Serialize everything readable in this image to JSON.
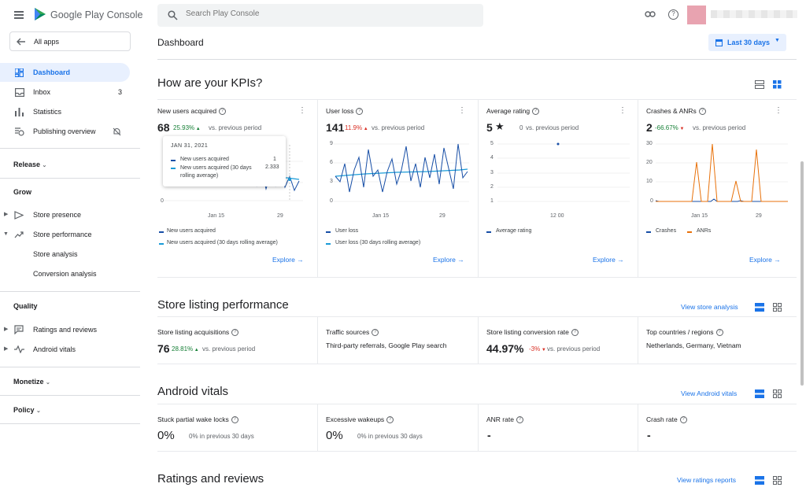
{
  "app": {
    "name": "Google Play Console"
  },
  "search": {
    "placeholder": "Search Play Console"
  },
  "sidebar": {
    "all_apps": "All apps",
    "items": [
      {
        "label": "Dashboard"
      },
      {
        "label": "Inbox",
        "count": "3"
      },
      {
        "label": "Statistics"
      },
      {
        "label": "Publishing overview"
      }
    ],
    "sections": {
      "release": "Release",
      "grow": "Grow",
      "quality": "Quality",
      "monetize": "Monetize",
      "policy": "Policy"
    },
    "grow_items": [
      "Store presence",
      "Store performance",
      "Store analysis",
      "Conversion analysis"
    ],
    "quality_items": [
      "Ratings and reviews",
      "Android vitals"
    ]
  },
  "header": {
    "title": "Dashboard",
    "date_range": "Last 30 days"
  },
  "kpis": {
    "title": "How are your KPIs?",
    "cards": [
      {
        "title": "New users acquired",
        "value": "68",
        "delta": "25.93%",
        "vs": "vs. previous period",
        "legend": [
          "New users acquired",
          "New users acquired (30 days rolling average)"
        ],
        "explore": "Explore",
        "ticks_x": [
          "Jan 15",
          "29"
        ],
        "ticks_y": [
          "0"
        ]
      },
      {
        "title": "User loss",
        "value": "141",
        "delta": "11.9%",
        "vs": "vs. previous period",
        "legend": [
          "User loss",
          "User loss (30 days rolling average)"
        ],
        "explore": "Explore",
        "ticks_x": [
          "Jan 15",
          "29"
        ],
        "ticks_y": [
          "9",
          "6",
          "3",
          "0"
        ]
      },
      {
        "title": "Average rating",
        "value": "5",
        "delta": "0",
        "vs": "vs. previous period",
        "legend": [
          "Average rating"
        ],
        "explore": "Explore",
        "ticks_x": [
          "12 00"
        ],
        "ticks_y": [
          "5",
          "4",
          "3",
          "2",
          "1"
        ]
      },
      {
        "title": "Crashes & ANRs",
        "value": "2",
        "delta": "-66.67%",
        "vs": "vs. previous period",
        "legend": [
          "Crashes",
          "ANRs"
        ],
        "explore": "Explore",
        "ticks_x": [
          "Jan 15",
          "29"
        ],
        "ticks_y": [
          "30",
          "20",
          "10",
          "0"
        ]
      }
    ],
    "tooltip": {
      "date": "JAN 31, 2021",
      "rows": [
        {
          "label": "New users acquired",
          "value": "1"
        },
        {
          "label": "New users acquired (30 days rolling average)",
          "value": "2.333"
        }
      ]
    }
  },
  "store_listing": {
    "title": "Store listing performance",
    "link": "View store analysis",
    "cells": [
      {
        "title": "Store listing acquisitions",
        "value": "76",
        "delta": "28.81%",
        "vs": "vs. previous period"
      },
      {
        "title": "Traffic sources",
        "text": "Third-party referrals, Google Play search"
      },
      {
        "title": "Store listing conversion rate",
        "value": "44.97%",
        "delta": "-3%",
        "vs": "vs. previous period"
      },
      {
        "title": "Top countries / regions",
        "text": "Netherlands, Germany, Vietnam"
      }
    ]
  },
  "vitals": {
    "title": "Android vitals",
    "link": "View Android vitals",
    "cells": [
      {
        "title": "Stuck partial wake locks",
        "value": "0%",
        "note": "0% in previous 30 days"
      },
      {
        "title": "Excessive wakeups",
        "value": "0%",
        "note": "0% in previous 30 days"
      },
      {
        "title": "ANR rate",
        "value": "-"
      },
      {
        "title": "Crash rate",
        "value": "-"
      }
    ]
  },
  "ratings": {
    "title": "Ratings and reviews",
    "link": "View ratings reports"
  },
  "colors": {
    "accent": "#1a73e8",
    "selected_bg": "#e8f0fe",
    "navy": "#174ea6",
    "teal": "#1a9bd7",
    "orange": "#e8710a",
    "green": "#188038",
    "red": "#d93025"
  }
}
